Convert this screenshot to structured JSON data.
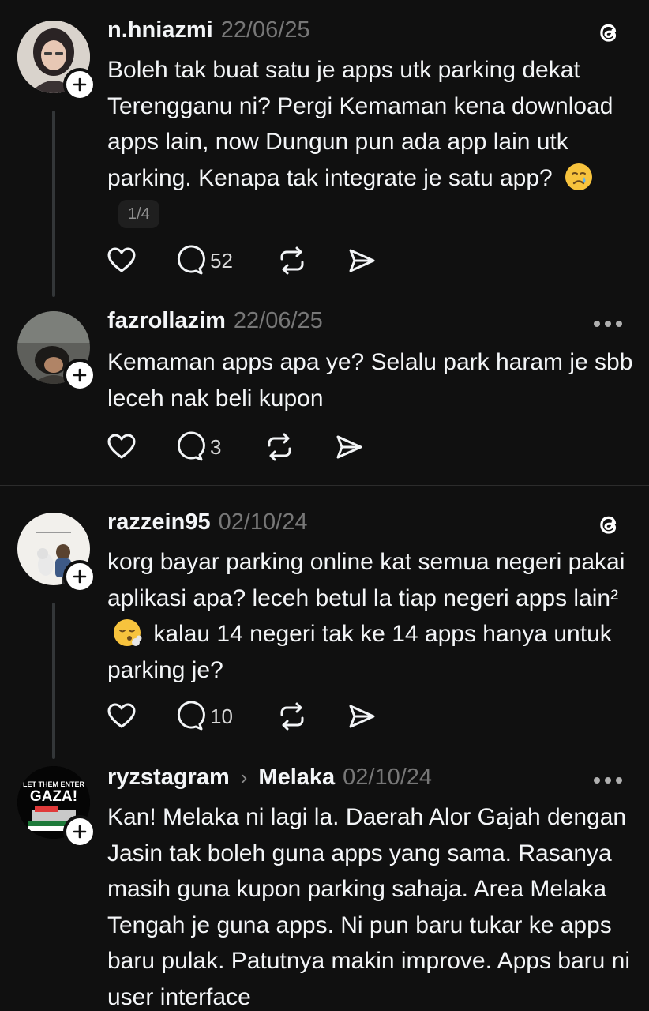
{
  "posts": [
    {
      "username": "n.hniazmi",
      "date": "22/06/25",
      "text": "Boleh tak buat satu je apps utk parking dekat Terengganu ni? Pergi Kemaman kena download apps lain, now Dungun pun ada app lain utk parking. Kenapa tak integrate je satu app?",
      "emoji": "crying-face",
      "pager": "1/4",
      "reply_count": "52",
      "header_icon": "threads-logo-icon"
    },
    {
      "username": "fazrollazim",
      "date": "22/06/25",
      "text": "Kemaman apps apa ye? Selalu park haram je sbb leceh nak beli kupon",
      "reply_count": "3",
      "header_icon": "more-icon"
    },
    {
      "username": "razzein95",
      "date": "02/10/24",
      "text_part1": "korg bayar parking online kat semua negeri pakai aplikasi apa? leceh betul la tiap negeri apps lain²",
      "emoji": "face-exhaling",
      "text_part2": "kalau 14 negeri tak ke 14 apps hanya untuk parking je?",
      "reply_count": "10",
      "header_icon": "threads-logo-icon"
    },
    {
      "username": "ryzstagram",
      "topic": "Melaka",
      "date": "02/10/24",
      "text": "Kan! Melaka ni lagi la. Daerah Alor Gajah dengan Jasin tak boleh guna apps yang sama. Rasanya masih guna kupon parking sahaja. Area Melaka Tengah je guna apps. Ni pun baru tukar ke apps baru pulak. Patutnya makin improve. Apps baru ni user interface",
      "avatar_text": [
        "LET THEM ENTER",
        "GAZA!"
      ],
      "header_icon": "more-icon"
    }
  ],
  "colors": {
    "background": "#101010",
    "text": "#f3f5f7",
    "muted": "#777777",
    "thread_line": "#333638"
  }
}
